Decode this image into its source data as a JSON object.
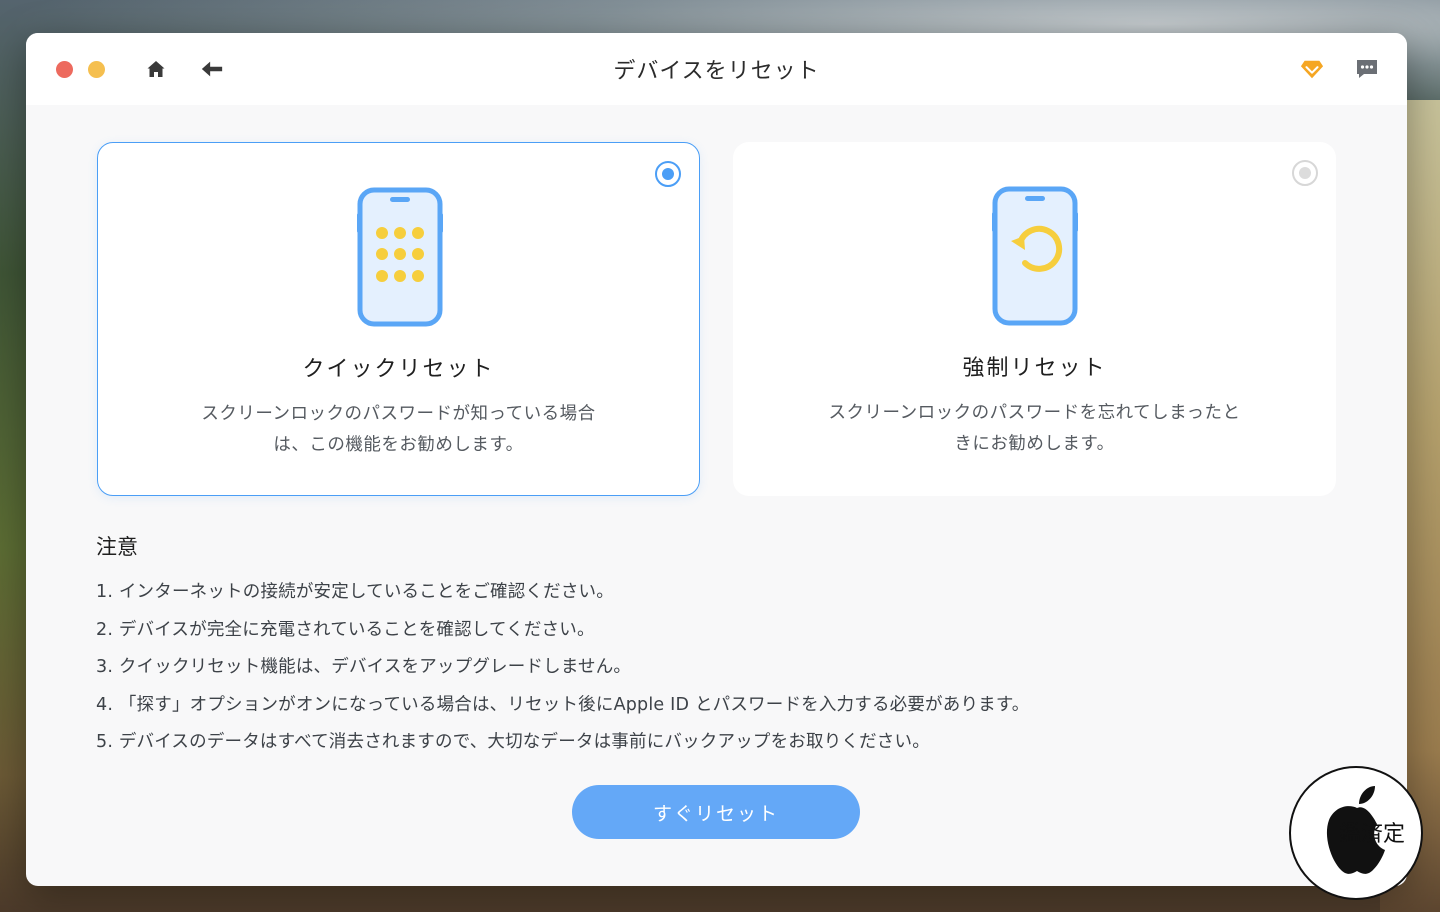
{
  "window": {
    "title": "デバイスをリセット"
  },
  "toolbar": {
    "home_icon": "home-icon",
    "back_icon": "back-arrow-icon",
    "premium_icon": "diamond-icon",
    "feedback_icon": "chat-bubble-icon"
  },
  "modes": [
    {
      "title": "クイックリセット",
      "description_line1": "スクリーンロックのパスワードが知っている場合",
      "description_line2": "は、この機能をお勧めします。",
      "selected": true,
      "icon": "phone-keypad-icon"
    },
    {
      "title": "強制リセット",
      "description_line1": "スクリーンロックのパスワードを忘れてしまったと",
      "description_line2": "きにお勧めします。",
      "selected": false,
      "icon": "phone-reset-icon"
    }
  ],
  "notes": {
    "title": "注意",
    "items": [
      "1. インターネットの接続が安定していることをご確認ください。",
      "2. デバイスが完全に充電されていることを確認してください。",
      "3. クイックリセット機能は、デバイスをアップグレードしません。",
      "4. 「探す」オプションがオンになっている場合は、リセット後にApple ID とパスワードを入力する必要があります。",
      "5. デバイスのデータはすべて消去されますので、大切なデータは事前にバックアップをお取りください。"
    ]
  },
  "action": {
    "reset_label": "すぐリセット"
  },
  "watermark": {
    "text": "鑑済定"
  },
  "colors": {
    "accent": "#4b9ef6",
    "button": "#64a8f7",
    "icon_yellow": "#f6ce3d"
  }
}
